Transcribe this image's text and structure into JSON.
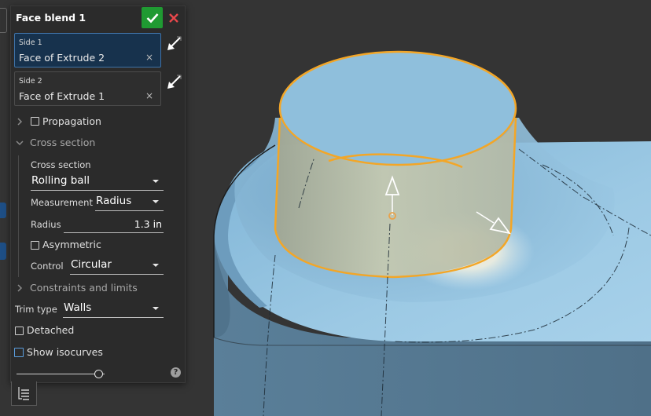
{
  "panel": {
    "title": "Face blend 1",
    "side1": {
      "label": "Side 1",
      "value": "Face of Extrude 2",
      "clear": "×"
    },
    "side2": {
      "label": "Side 2",
      "value": "Face of Extrude 1",
      "clear": "×"
    },
    "propagation_label": "Propagation",
    "cross_section_header": "Cross section",
    "cross_section_label": "Cross section",
    "cross_section_value": "Rolling ball",
    "measurement_label": "Measurement",
    "measurement_value": "Radius",
    "radius_label": "Radius",
    "radius_value": "1.3 in",
    "asymmetric_label": "Asymmetric",
    "control_label": "Control",
    "control_value": "Circular",
    "constraints_header": "Constraints and limits",
    "trim_type_label": "Trim type",
    "trim_type_value": "Walls",
    "detached_label": "Detached",
    "show_isocurves_label": "Show isocurves",
    "help_glyph": "?",
    "slider_fraction": 0.93
  },
  "colors": {
    "accept_green": "#1f9a32",
    "cancel_red": "#e8474b",
    "selection_orange": "#f3a627",
    "part_blue": "#8fbfdc",
    "active_field_blue": "#17324d"
  },
  "icons": {
    "accept": "check-icon",
    "cancel": "close-icon",
    "select_arrow": "selection-arrow-icon",
    "expand": "chevron-right-icon",
    "collapse": "chevron-down-icon",
    "help": "help-circle-icon",
    "list": "feature-list-icon"
  }
}
